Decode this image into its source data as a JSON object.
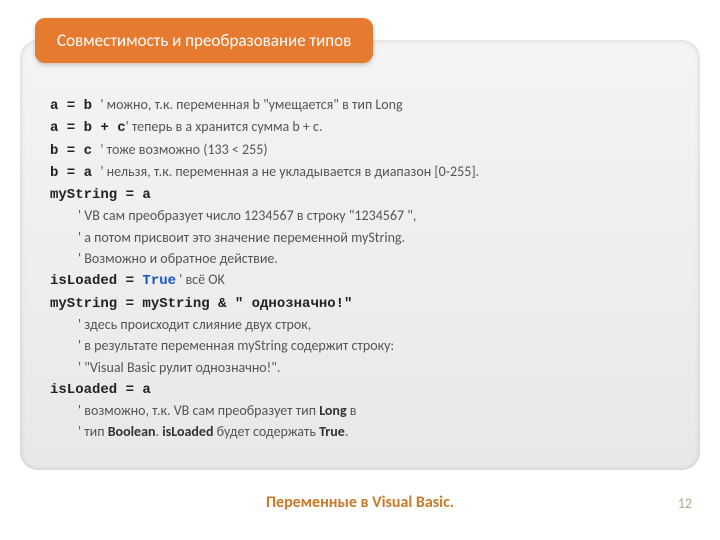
{
  "ribbon": "Совместимость и преобразование типов",
  "lines": {
    "l1a": "a = b ",
    "l1b": "' можно, т.к. переменная b \"умещается\" в тип Long",
    "l2a": "a = b + c",
    "l2b": "' теперь в a хранится сумма b + c.",
    "l3a": "b = c ",
    "l3b": "        ' тоже возможно (133 < 255)",
    "l4a": "b = a ",
    "l4b": "' нельзя, т.к. переменная a не укладывается в диапазон [0-255].",
    "l5": "myString = a",
    "l6": "' VB сам преобразует число 1234567 в строку \"1234567 \",",
    "l7": "' а потом присвоит это значение переменной myString.",
    "l8": "' Возможно и обратное действие.",
    "l9a": "isLoaded = ",
    "l9b": "True",
    "l9c": " ' всё OK",
    "l10": "myString = myString & \" однозначно!\"",
    "l11": "' здесь происходит слияние двух строк,",
    "l12": "' в результате переменная myString содержит строку:",
    "l13": "' \"Visual Basic рулит однозначно!\".",
    "l14": "isLoaded = a",
    "l15a": "' возможно, т.к. VB сам преобразует тип ",
    "l15b": "Long",
    "l15c": " в",
    "l16a": "' тип ",
    "l16b": "Boolean",
    "l16c": ". ",
    "l16d": "isLoaded",
    "l16e": " будет содержать ",
    "l16f": "True",
    "l16g": "."
  },
  "footer": "Переменные в Visual Basic.",
  "page": "12"
}
